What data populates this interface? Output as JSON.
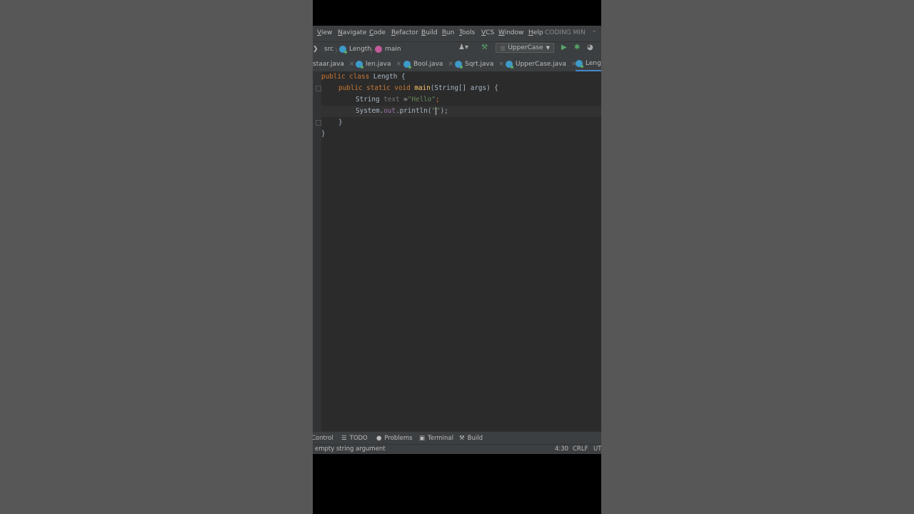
{
  "menu": [
    "View",
    "Navigate",
    "Code",
    "Refactor",
    "Build",
    "Run",
    "Tools",
    "VCS",
    "Window",
    "Help"
  ],
  "project_name": "CODING MIN",
  "breadcrumbs": [
    "src",
    "Length",
    "main"
  ],
  "run_config": "UpperCase",
  "tabs": [
    "staar.java",
    "len.java",
    "Bool.java",
    "Sqrt.java",
    "UpperCase.java",
    "Lengt"
  ],
  "active_tab": 5,
  "code": {
    "l1_a": "public class ",
    "l1_b": "Length {",
    "l2_a": "public static void ",
    "l2_fn": "main",
    "l2_b": "(String[] args) {",
    "l3_a": "String ",
    "l3_var": "text",
    "l3_b": " =",
    "l3_str": "\"Hello\"",
    "l3_c": ";",
    "l4_a": "System.",
    "l4_fld": "out",
    "l4_b": ".println(",
    "l4_q1": "\"",
    "l4_q2": "\"",
    "l4_c": ");",
    "l5": "}",
    "l6": "}"
  },
  "toolwindows": [
    "Control",
    "TODO",
    "Problems",
    "Terminal",
    "Build"
  ],
  "status": {
    "message": "empty string argument",
    "position": "4:30",
    "line_sep": "CRLF",
    "encoding": "UT"
  },
  "colors": {
    "background": "#575757",
    "editor_bg": "#2b2b2b",
    "toolbar_bg": "#3c3f41",
    "keyword": "#cc7832",
    "string": "#6a8759",
    "method": "#ffc66d",
    "accent": "#4a88c7"
  }
}
